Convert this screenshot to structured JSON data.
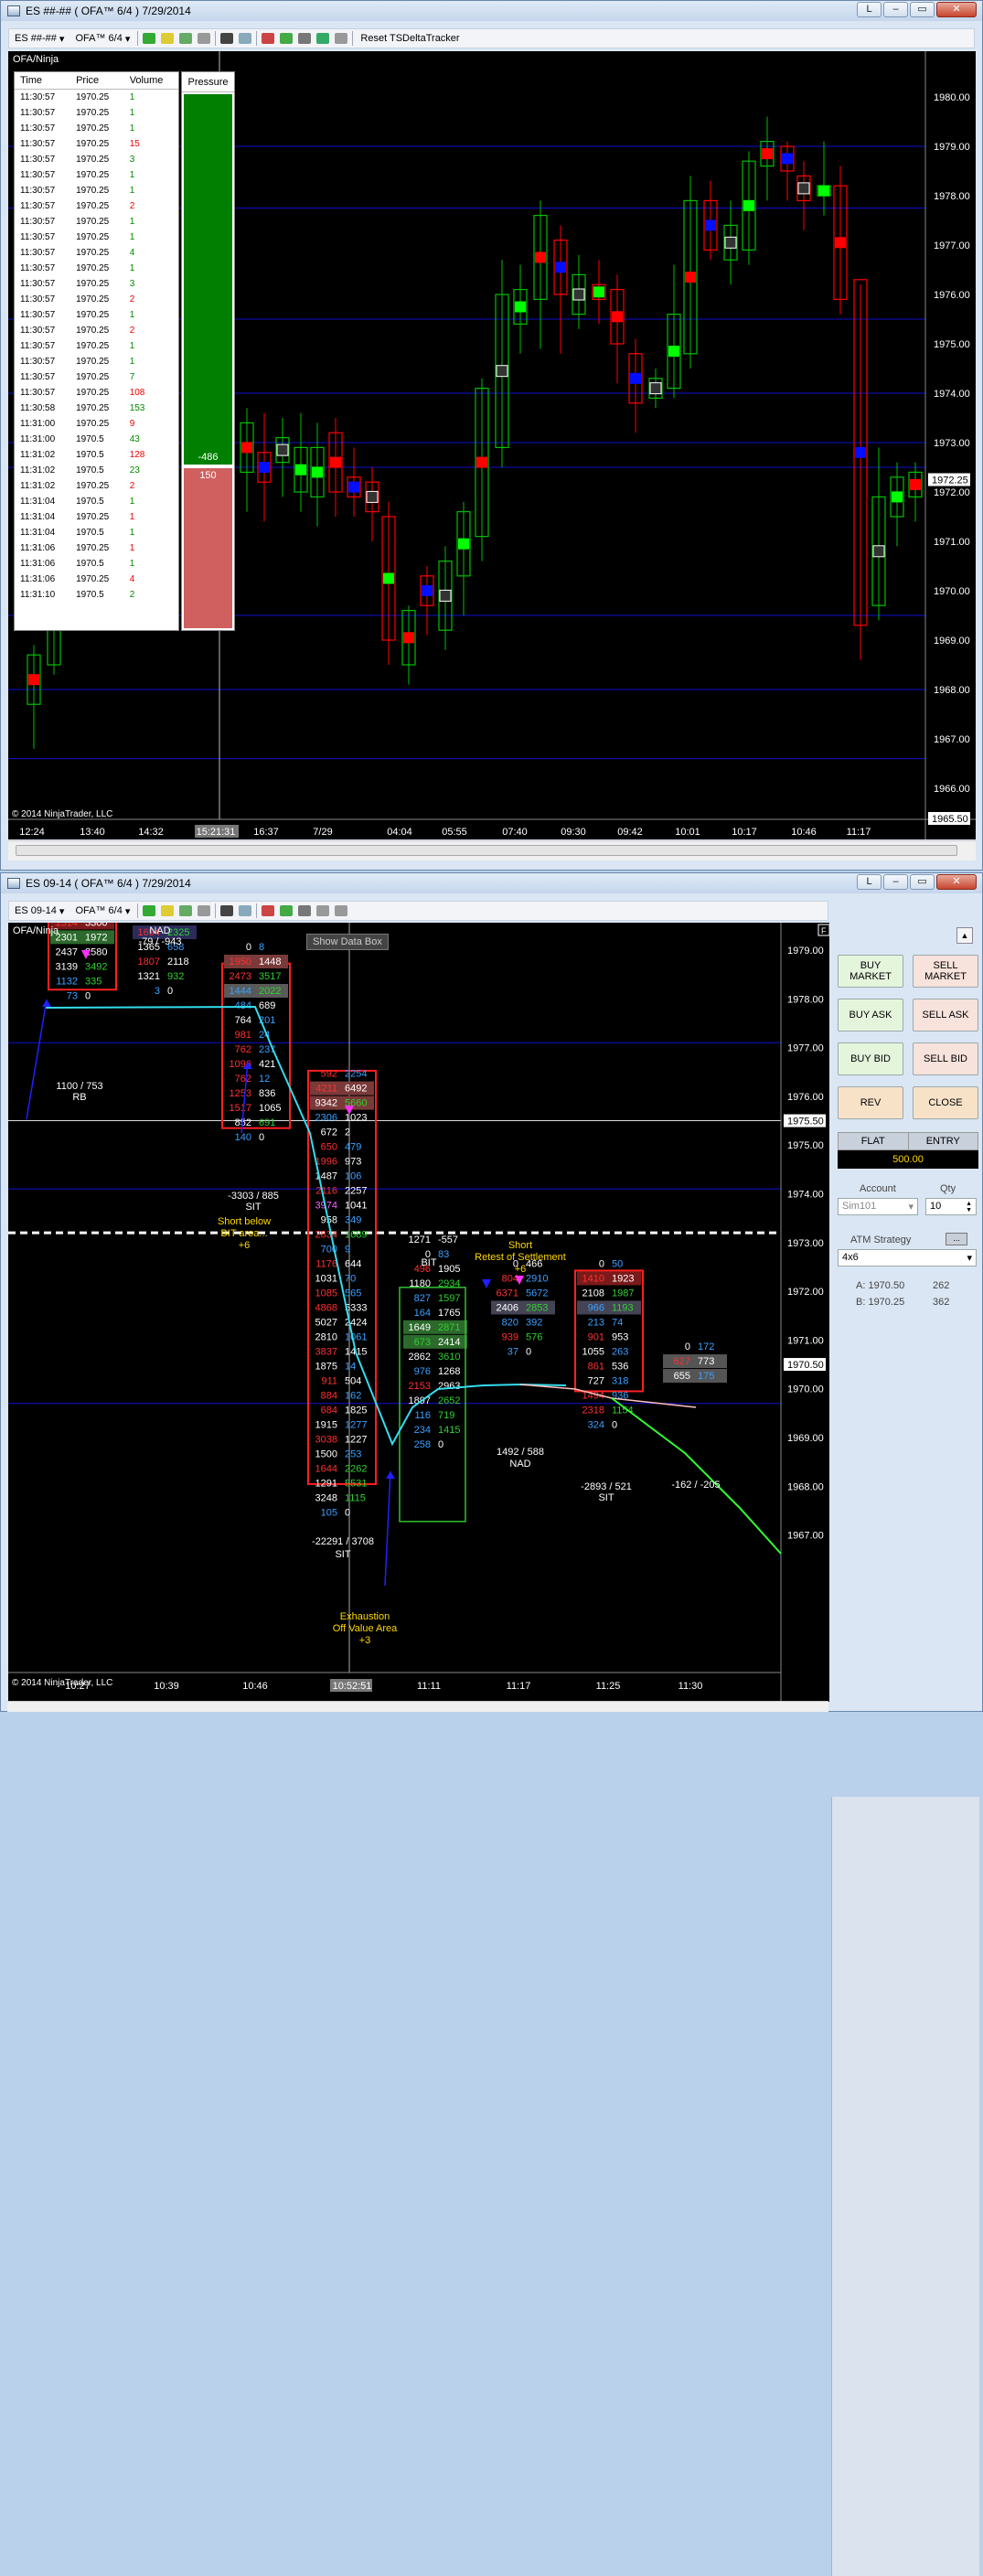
{
  "window1": {
    "title": "ES ##-## ( OFA™ 6/4 )  7/29/2014",
    "toolbar": {
      "instrument": "ES ##-##",
      "interval": "OFA™ 6/4",
      "reset": "Reset TSDeltaTracker"
    },
    "panel_label": "OFA/Ninja",
    "copyright": "© 2014 NinjaTrader, LLC",
    "ladder": {
      "headers": [
        "Time",
        "Price",
        "Volume"
      ],
      "rows": [
        [
          "11:30:57",
          "1970.25",
          "1"
        ],
        [
          "11:30:57",
          "1970.25",
          "1"
        ],
        [
          "11:30:57",
          "1970.25",
          "1"
        ],
        [
          "11:30:57",
          "1970.25",
          "15"
        ],
        [
          "11:30:57",
          "1970.25",
          "3"
        ],
        [
          "11:30:57",
          "1970.25",
          "1"
        ],
        [
          "11:30:57",
          "1970.25",
          "1"
        ],
        [
          "11:30:57",
          "1970.25",
          "2"
        ],
        [
          "11:30:57",
          "1970.25",
          "1"
        ],
        [
          "11:30:57",
          "1970.25",
          "1"
        ],
        [
          "11:30:57",
          "1970.25",
          "4"
        ],
        [
          "11:30:57",
          "1970.25",
          "1"
        ],
        [
          "11:30:57",
          "1970.25",
          "3"
        ],
        [
          "11:30:57",
          "1970.25",
          "2"
        ],
        [
          "11:30:57",
          "1970.25",
          "1"
        ],
        [
          "11:30:57",
          "1970.25",
          "2"
        ],
        [
          "11:30:57",
          "1970.25",
          "1"
        ],
        [
          "11:30:57",
          "1970.25",
          "1"
        ],
        [
          "11:30:57",
          "1970.25",
          "7"
        ],
        [
          "11:30:57",
          "1970.25",
          "108"
        ],
        [
          "11:30:58",
          "1970.25",
          "153"
        ],
        [
          "11:31:00",
          "1970.25",
          "9"
        ],
        [
          "11:31:00",
          "1970.5",
          "43"
        ],
        [
          "11:31:02",
          "1970.5",
          "128"
        ],
        [
          "11:31:02",
          "1970.5",
          "23"
        ],
        [
          "11:31:02",
          "1970.25",
          "2"
        ],
        [
          "11:31:04",
          "1970.5",
          "1"
        ],
        [
          "11:31:04",
          "1970.25",
          "1"
        ],
        [
          "11:31:04",
          "1970.5",
          "1"
        ],
        [
          "11:31:06",
          "1970.25",
          "1"
        ],
        [
          "11:31:06",
          "1970.5",
          "1"
        ],
        [
          "11:31:06",
          "1970.25",
          "4"
        ],
        [
          "11:31:10",
          "1970.5",
          "2"
        ]
      ],
      "row_colors": [
        "g",
        "g",
        "g",
        "r",
        "g",
        "g",
        "g",
        "r",
        "g",
        "g",
        "g",
        "g",
        "g",
        "r",
        "g",
        "r",
        "g",
        "g",
        "g",
        "r",
        "g",
        "r",
        "g",
        "r",
        "g",
        "r",
        "g",
        "r",
        "g",
        "r",
        "g",
        "r",
        "g"
      ]
    },
    "pressure": {
      "header": "Pressure",
      "buy_value": "-486",
      "sell_value": "150"
    },
    "price_axis": [
      "1980.00",
      "1979.00",
      "1978.00",
      "1977.00",
      "1976.00",
      "1975.00",
      "1974.00",
      "1973.00",
      "1972.00",
      "1971.00",
      "1970.00",
      "1969.00",
      "1968.00",
      "1967.00",
      "1966.00"
    ],
    "current_price": "1972.25",
    "bottom_price": "1965.50",
    "time_axis": [
      "12:24",
      "13:40",
      "14:32",
      "15:21:31",
      "16:37",
      "7/29",
      "04:04",
      "05:55",
      "07:40",
      "09:30",
      "09:42",
      "10:01",
      "10:17",
      "10:46",
      "11:17"
    ]
  },
  "window2": {
    "title": "ES 09-14 ( OFA™ 6/4 )  7/29/2014",
    "toolbar": {
      "instrument": "ES 09-14",
      "interval": "OFA™ 6/4"
    },
    "panel_label": "OFA/Ninja",
    "show_data_box": "Show Data Box",
    "copyright": "© 2014 NinjaTrader, LLC",
    "price_axis": [
      "1979.00",
      "1978.00",
      "1977.00",
      "1976.00",
      "1975.00",
      "1974.00",
      "1973.00",
      "1972.00",
      "1971.00",
      "1970.00",
      "1969.00",
      "1968.00",
      "1967.00"
    ],
    "marker_price": "1975.50",
    "current_price": "1970.50",
    "time_axis": [
      "10:27",
      "10:39",
      "10:46",
      "10:52:51",
      "11:11",
      "11:17",
      "11:25",
      "11:30"
    ],
    "annotations": {
      "nad_top": "NAD",
      "nad_top_val": "-79 / -943",
      "b1_sum": "1100 / 753",
      "b1_tag": "RB",
      "b3_sum": "-3303 / 885",
      "b3_tag": "SIT",
      "short_bit": "Short below",
      "short_bit2": "BIT area...",
      "short_bit3": "+6",
      "b4_sum": "-22291 / 3708",
      "b4_tag": "SIT",
      "bit": "BIT",
      "short_retest": "Short",
      "short_retest2": "Retest of Settlement",
      "short_retest3": "+6",
      "b6_sum": "1492 / 588",
      "b6_tag": "NAD",
      "b7_sum": "-2893 / 521",
      "b7_tag": "SIT",
      "b8_sum": "-162 / -205",
      "exhaust": "Exhaustion",
      "exhaust2": "Off Value Area",
      "exhaust3": "+3"
    },
    "order": {
      "buy_market": "BUY MARKET",
      "sell_market": "SELL MARKET",
      "buy_ask": "BUY ASK",
      "sell_ask": "SELL ASK",
      "buy_bid": "BUY BID",
      "sell_bid": "SELL BID",
      "rev": "REV",
      "close": "CLOSE",
      "flat": "FLAT",
      "entry": "ENTRY",
      "pnl": "500.00",
      "account_lbl": "Account",
      "qty_lbl": "Qty",
      "account": "Sim101",
      "qty": "10",
      "atm_lbl": "ATM Strategy",
      "atm": "4x6",
      "ask": "A: 1970.50",
      "ask_sz": "262",
      "bid": "B: 1970.25",
      "bid_sz": "362"
    }
  },
  "colors": {
    "up": "#00c000",
    "down": "#ff0000",
    "grid": "#0000c8",
    "cyan": "#33ddee"
  }
}
